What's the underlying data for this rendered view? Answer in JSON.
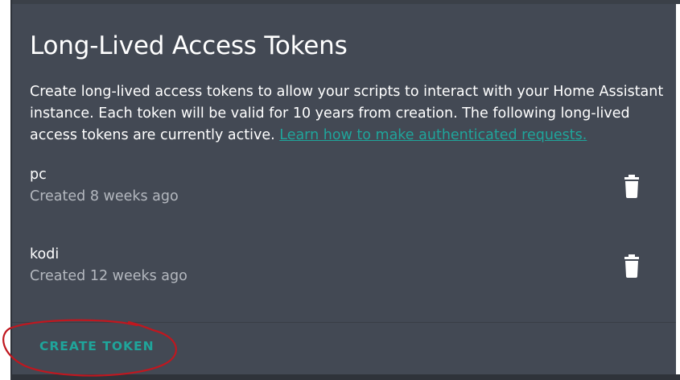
{
  "card": {
    "title": "Long-Lived Access Tokens",
    "description_text": "Create long-lived access tokens to allow your scripts to interact with your Home Assistant instance. Each token will be valid for 10 years from creation. The following long-lived access tokens are currently active. ",
    "learn_link": "Learn how to make authenticated requests."
  },
  "tokens": [
    {
      "name": "pc",
      "created": "Created 8 weeks ago"
    },
    {
      "name": "kodi",
      "created": "Created 12 weeks ago"
    }
  ],
  "actions": {
    "create_label": "CREATE TOKEN"
  },
  "icons": {
    "delete": "trash-icon"
  },
  "colors": {
    "card_background": "#434954",
    "accent": "#1fa59b",
    "annotation": "#c0171f"
  }
}
